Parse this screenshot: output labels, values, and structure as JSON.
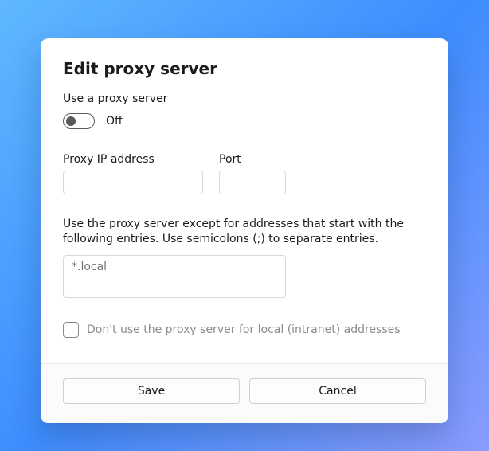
{
  "dialog": {
    "title": "Edit proxy server",
    "use_proxy_label": "Use a proxy server",
    "toggle_state": "Off",
    "proxy_ip_label": "Proxy IP address",
    "proxy_ip_value": "",
    "port_label": "Port",
    "port_value": "",
    "exceptions_text": "Use the proxy server except for addresses that start with the following entries. Use semicolons (;) to separate entries.",
    "exceptions_placeholder": "*.local",
    "exceptions_value": "",
    "local_checkbox_label": "Don't use the proxy server for local (intranet) addresses",
    "local_checkbox_checked": false,
    "save_label": "Save",
    "cancel_label": "Cancel"
  }
}
